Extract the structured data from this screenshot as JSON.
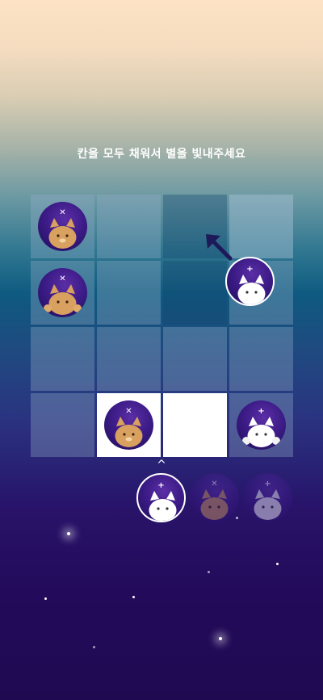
{
  "instruction": "칸을 모두 채워서 별을 빛내주세요",
  "colors": {
    "token_dark": "#2a1470",
    "fox": "#d9a15f",
    "white_fox": "#ffffff",
    "brown_fox": "#8a5a48",
    "gray_fox": "#9a90b8"
  },
  "board": {
    "rows": 4,
    "cols": 4,
    "cells": [
      {
        "row": 1,
        "col": 1,
        "token": "fox",
        "mark": "✕"
      },
      {
        "row": 1,
        "col": 2,
        "token": null
      },
      {
        "row": 1,
        "col": 3,
        "token": null
      },
      {
        "row": 1,
        "col": 4,
        "token": null
      },
      {
        "row": 2,
        "col": 1,
        "token": "fox-paws",
        "mark": "✕"
      },
      {
        "row": 2,
        "col": 2,
        "token": null
      },
      {
        "row": 2,
        "col": 3,
        "token": null
      },
      {
        "row": 2,
        "col": 4,
        "token": "white-fox",
        "mark": "+"
      },
      {
        "row": 3,
        "col": 1,
        "token": null
      },
      {
        "row": 3,
        "col": 2,
        "token": null
      },
      {
        "row": 3,
        "col": 3,
        "token": null
      },
      {
        "row": 3,
        "col": 4,
        "token": null
      },
      {
        "row": 4,
        "col": 1,
        "token": null
      },
      {
        "row": 4,
        "col": 2,
        "token": "fox",
        "mark": "✕"
      },
      {
        "row": 4,
        "col": 3,
        "token": null
      },
      {
        "row": 4,
        "col": 4,
        "token": "white-fox-paws",
        "mark": "+"
      }
    ]
  },
  "tray": [
    {
      "token": "white-fox",
      "mark": "+",
      "selected": true
    },
    {
      "token": "brown-fox",
      "mark": "✕",
      "selected": false
    },
    {
      "token": "gray-fox",
      "mark": "+",
      "selected": false
    }
  ],
  "drag_hint": {
    "icon": "arrow-up-left-icon"
  },
  "caret": "^"
}
